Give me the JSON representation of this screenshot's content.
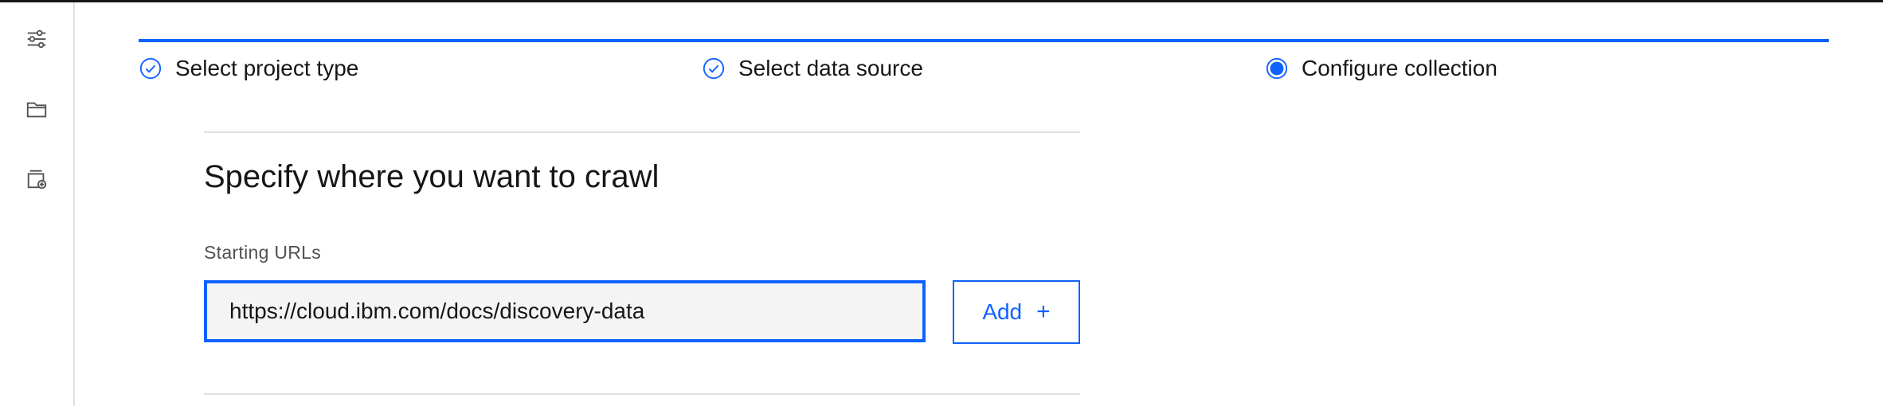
{
  "nav": {
    "icons": [
      "settings-sliders-icon",
      "folder-icon",
      "collection-add-icon"
    ]
  },
  "progress": {
    "steps": [
      {
        "label": "Select project type",
        "status": "complete"
      },
      {
        "label": "Select data source",
        "status": "complete"
      },
      {
        "label": "Configure collection",
        "status": "current"
      }
    ]
  },
  "form": {
    "heading": "Specify where you want to crawl",
    "starting_urls_label": "Starting URLs",
    "starting_url_value": "https://cloud.ibm.com/docs/discovery-data",
    "add_label": "Add",
    "add_icon": "+"
  },
  "colors": {
    "accent": "#0f62fe",
    "text": "#161616",
    "divider": "#e0e0e0"
  }
}
